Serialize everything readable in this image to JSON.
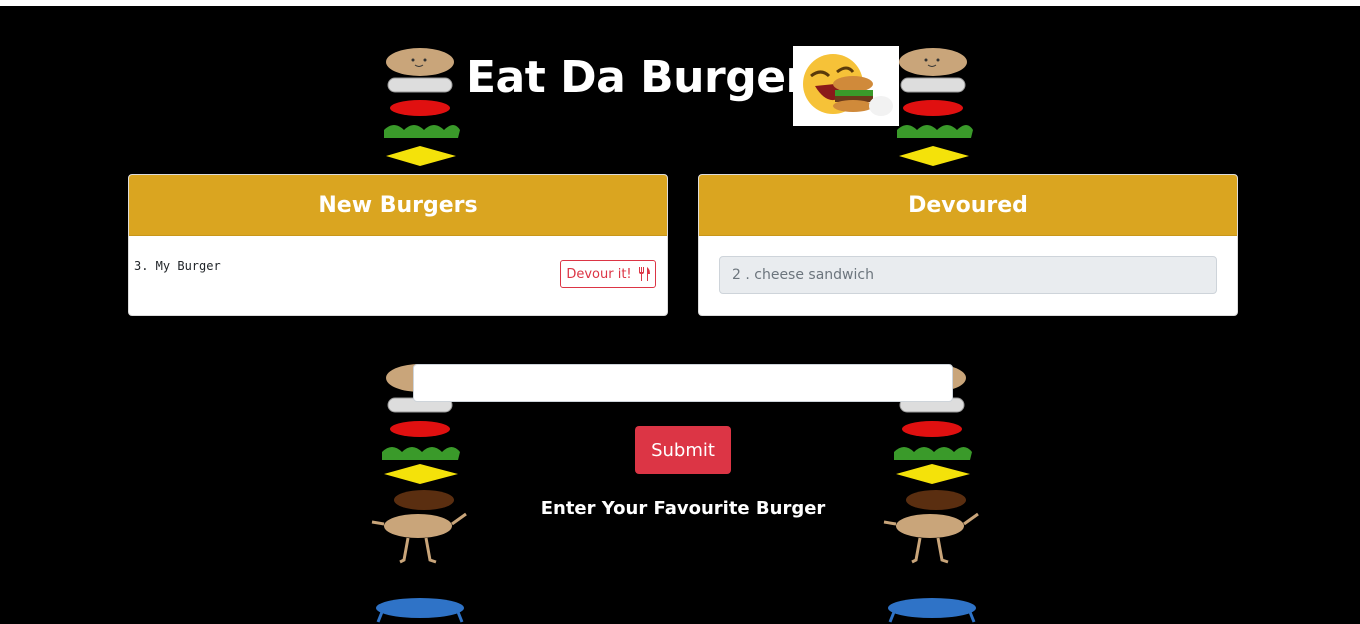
{
  "app": {
    "title": "Eat Da Burger"
  },
  "new_burgers": {
    "header": "New Burgers",
    "items": [
      {
        "label": "3. My Burger",
        "button_label": "Devour it!"
      }
    ]
  },
  "devoured": {
    "header": "Devoured",
    "items": [
      {
        "label": "2 . cheese sandwich"
      }
    ]
  },
  "form": {
    "input_value": "",
    "submit_label": "Submit",
    "caption": "Enter Your Favourite Burger"
  },
  "colors": {
    "accent": "#daa520",
    "danger": "#dc3545",
    "background": "#000000"
  },
  "icons": {
    "devour": "utensils-icon",
    "deco": "stacked-burger-icon",
    "header_image": "laughing-emoji-burger-icon"
  }
}
